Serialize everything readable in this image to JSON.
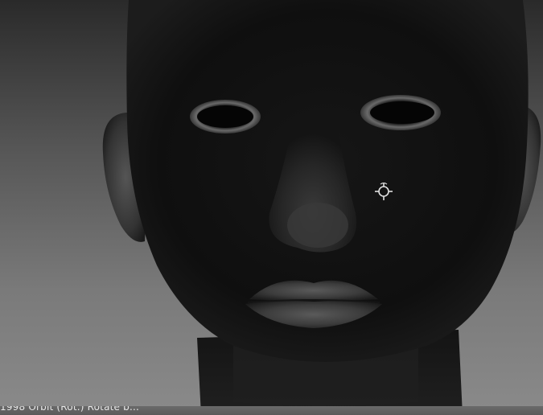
{
  "viewport": {
    "gizmo_icon": "transform-gizmo-icon",
    "background_top": "#2a2a2a",
    "background_bottom": "#8a8a8a"
  },
  "status_bar": {
    "text": "1998 Orbit (Rot.) Rotate b..."
  }
}
